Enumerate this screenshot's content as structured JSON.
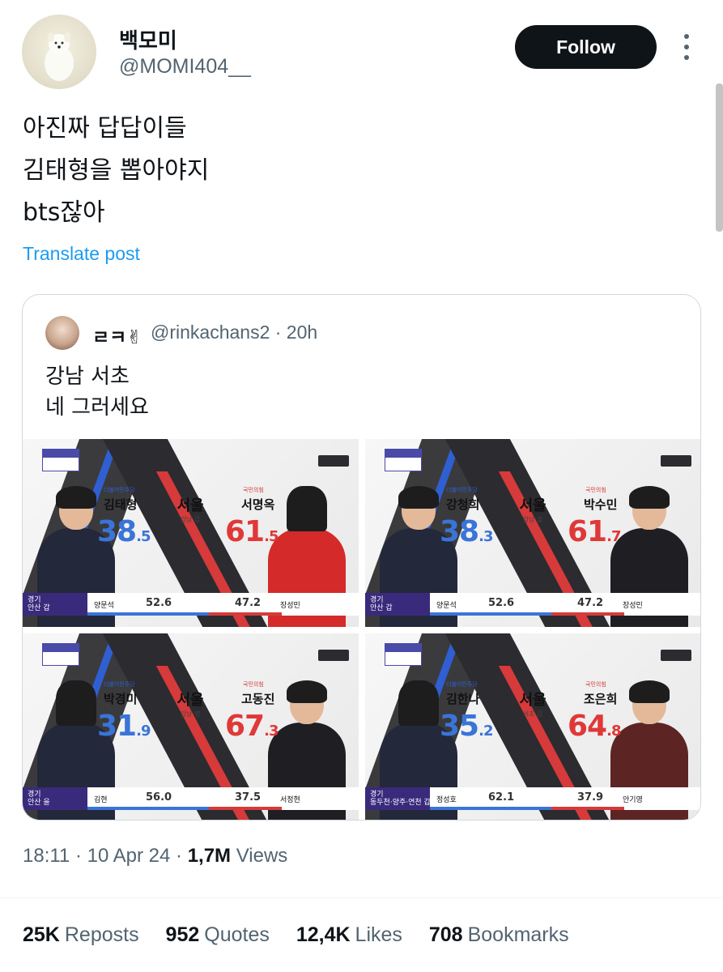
{
  "author": {
    "display_name": "백모미",
    "handle": "@MOMI404__",
    "follow_label": "Follow"
  },
  "tweet": {
    "lines": [
      "아진짜 답답이들",
      "김태형을 뽑아야지",
      "bts잖아"
    ],
    "translate_label": "Translate post"
  },
  "quote": {
    "author_name": "ㄹㅋ✌",
    "handle_time": "@rinkachans2 · 20h",
    "lines": [
      "강남 서초",
      "네 그러세요"
    ]
  },
  "media": [
    {
      "left_party": "더불어민주당",
      "left_name": "김태형",
      "left_pct_int": "38",
      "left_pct_dec": ".5",
      "right_party": "국민의힘",
      "right_name": "서명옥",
      "right_pct_int": "61",
      "right_pct_dec": ".5",
      "city": "서울",
      "district": "강남 갑",
      "bar_region": "경기",
      "bar_district": "안산 갑",
      "bar_left_name": "양문석",
      "bar_left_val": "52.6",
      "bar_right_val": "47.2",
      "bar_right_name": "장성민"
    },
    {
      "left_party": "더불어민주당",
      "left_name": "강청희",
      "left_pct_int": "38",
      "left_pct_dec": ".3",
      "right_party": "국민의힘",
      "right_name": "박수민",
      "right_pct_int": "61",
      "right_pct_dec": ".7",
      "city": "서울",
      "district": "강남 을",
      "bar_region": "경기",
      "bar_district": "안산 갑",
      "bar_left_name": "양문석",
      "bar_left_val": "52.6",
      "bar_right_val": "47.2",
      "bar_right_name": "장성민"
    },
    {
      "left_party": "더불어민주당",
      "left_name": "박경미",
      "left_pct_int": "31",
      "left_pct_dec": ".9",
      "right_party": "국민의힘",
      "right_name": "고동진",
      "right_pct_int": "67",
      "right_pct_dec": ".3",
      "city": "서울",
      "district": "강남 병",
      "bar_region": "경기",
      "bar_district": "안산 을",
      "bar_left_name": "김현",
      "bar_left_val": "56.0",
      "bar_right_val": "37.5",
      "bar_right_name": "서정현"
    },
    {
      "left_party": "더불어민주당",
      "left_name": "김한나",
      "left_pct_int": "35",
      "left_pct_dec": ".2",
      "right_party": "국민의힘",
      "right_name": "조은희",
      "right_pct_int": "64",
      "right_pct_dec": ".8",
      "city": "서울",
      "district": "서초 갑",
      "bar_region": "경기",
      "bar_district": "동두천·양주·연천 갑",
      "bar_left_name": "정성호",
      "bar_left_val": "62.1",
      "bar_right_val": "37.9",
      "bar_right_name": "안기영"
    }
  ],
  "meta": {
    "time": "18:11 · 10 Apr 24 · ",
    "views_count": "1,7M",
    "views_label": " Views"
  },
  "stats": {
    "reposts_num": "25K",
    "reposts_label": "Reposts",
    "quotes_num": "952",
    "quotes_label": "Quotes",
    "likes_num": "12,4K",
    "likes_label": "Likes",
    "bookmarks_num": "708",
    "bookmarks_label": "Bookmarks"
  }
}
